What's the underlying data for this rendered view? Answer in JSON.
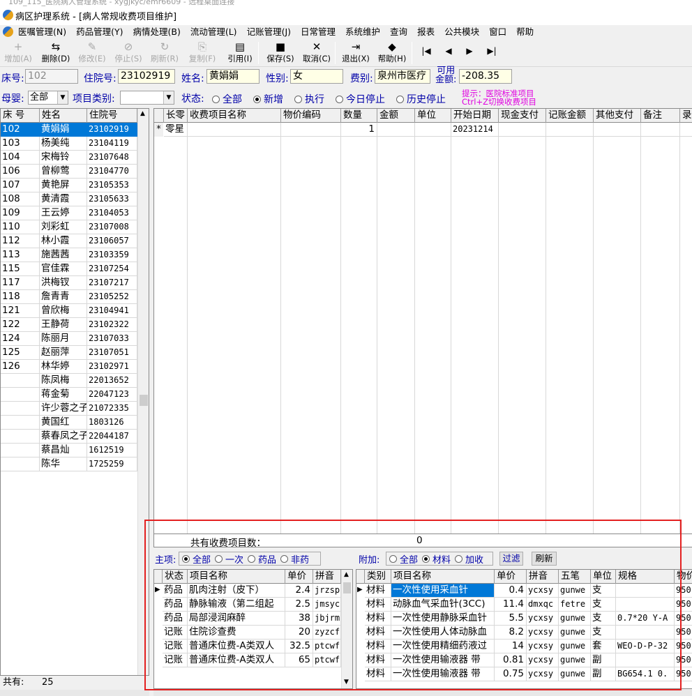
{
  "window": {
    "title_partial": "109_115_医院病人管理系统 - xygjkyc/emr6609 - 远程桌面连接",
    "title": "病区护理系统 - [病人常规收费项目维护]"
  },
  "menu": [
    "医嘱管理(N)",
    "药品管理(Y)",
    "病情处理(B)",
    "流动管理(L)",
    "记账管理(J)",
    "日常管理",
    "系统维护",
    "查询",
    "报表",
    "公共模块",
    "窗口",
    "帮助"
  ],
  "toolbar": [
    {
      "label": "增加(A)",
      "icon": "+",
      "enabled": false
    },
    {
      "label": "删除(D)",
      "icon": "⇆",
      "enabled": true
    },
    {
      "label": "修改(E)",
      "icon": "✎",
      "enabled": false
    },
    {
      "label": "停止(S)",
      "icon": "⊘",
      "enabled": false
    },
    {
      "label": "刷新(R)",
      "icon": "↻",
      "enabled": false
    },
    {
      "label": "复制(F)",
      "icon": "⎘",
      "enabled": false
    },
    {
      "label": "引用(I)",
      "icon": "▤",
      "enabled": true
    },
    {
      "label": "保存(S)",
      "icon": "■",
      "enabled": true
    },
    {
      "label": "取消(C)",
      "icon": "✕",
      "enabled": true
    },
    {
      "label": "退出(X)",
      "icon": "⇥",
      "enabled": true
    },
    {
      "label": "帮助(H)",
      "icon": "◆",
      "enabled": true
    }
  ],
  "nav": [
    "|◀",
    "◀",
    "▶",
    "▶|"
  ],
  "form": {
    "bed_label": "床号:",
    "bed_value": "102",
    "admission_label": "住院号:",
    "admission_value": "23102919",
    "name_label": "姓名:",
    "name_value": "黄娟娟",
    "gender_label": "性别:",
    "gender_value": "女",
    "fee_label": "费别:",
    "fee_value": "泉州市医疗",
    "balance_label_1": "可用",
    "balance_label_2": "金额:",
    "balance_value": "-208.35",
    "mother_label": "母婴:",
    "mother_value": "全部",
    "category_label": "项目类别:",
    "category_value": "",
    "status_label": "状态:",
    "status_options": [
      "全部",
      "新增",
      "执行",
      "今日停止",
      "历史停止"
    ],
    "status_selected": "新增",
    "hint_1": "提示：医院标准项目",
    "hint_2": "Ctrl+Z切换收费项目"
  },
  "patients": {
    "headers": [
      "床 号",
      "姓名",
      "住院号"
    ],
    "rows": [
      [
        "102",
        "黄娟娟",
        "23102919"
      ],
      [
        "103",
        "杨美纯",
        "23104119"
      ],
      [
        "104",
        "宋梅铃",
        "23107648"
      ],
      [
        "106",
        "曾柳莺",
        "23104770"
      ],
      [
        "107",
        "黄艳屏",
        "23105353"
      ],
      [
        "108",
        "黄清霞",
        "23105633"
      ],
      [
        "109",
        "王云婷",
        "23104053"
      ],
      [
        "110",
        "刘彩虹",
        "23107008"
      ],
      [
        "112",
        "林小霞",
        "23106057"
      ],
      [
        "113",
        "施茜茜",
        "23103359"
      ],
      [
        "115",
        "官佳霖",
        "23107254"
      ],
      [
        "117",
        "洪梅钗",
        "23107217"
      ],
      [
        "118",
        "詹青青",
        "23105252"
      ],
      [
        "121",
        "曾欣梅",
        "23104941"
      ],
      [
        "122",
        "王静荷",
        "23102322"
      ],
      [
        "124",
        "陈丽月",
        "23107033"
      ],
      [
        "125",
        "赵丽萍",
        "23107051"
      ],
      [
        "126",
        "林华婷",
        "23102971"
      ],
      [
        "",
        "陈凤梅",
        "22013652"
      ],
      [
        "",
        "蒋金菊",
        "22047123"
      ],
      [
        "",
        "许少蓉之子",
        "21072335"
      ],
      [
        "",
        "黄国红",
        "1803126"
      ],
      [
        "",
        "蔡春凤之子",
        "22044187"
      ],
      [
        "",
        "蔡昌灿",
        "1612519"
      ],
      [
        "",
        "陈华",
        "1725259"
      ]
    ],
    "footer_label": "共有:",
    "footer_count": "25"
  },
  "items": {
    "headers": [
      "长零",
      "收费项目名称",
      "物价编码",
      "数量",
      "金额",
      "单位",
      "开始日期",
      "现金支付",
      "记账金额",
      "其他支付",
      "备注",
      "录"
    ],
    "rows": [
      [
        "零星",
        "",
        "",
        "1",
        "",
        "",
        "20231214",
        "",
        "",
        "",
        "",
        ""
      ]
    ],
    "new_marker": "*",
    "summary_label": "共有收费项目数：",
    "summary_value": "0"
  },
  "main_panel": {
    "label": "主项:",
    "options": [
      "全部",
      "一次",
      "药品",
      "非药"
    ],
    "selected": "全部",
    "headers": [
      "状态",
      "项目名称",
      "单价",
      "拼音"
    ],
    "rows": [
      [
        "药品",
        "肌肉注射（皮下）",
        "2.4",
        "jrzsp"
      ],
      [
        "药品",
        "静脉输液（第二组起",
        "2.5",
        "jmsyc"
      ],
      [
        "药品",
        "局部浸润麻醉",
        "38",
        "jbjrm"
      ],
      [
        "记账",
        "住院诊查费",
        "20",
        "zyzcf"
      ],
      [
        "记账",
        "普通床位费-A类双人",
        "32.5",
        "ptcwf"
      ],
      [
        "记账",
        "普通床位费-A类双人",
        "65",
        "ptcwf"
      ]
    ]
  },
  "extra_panel": {
    "label": "附加:",
    "options": [
      "全部",
      "材料",
      "加收"
    ],
    "selected": "材料",
    "filter_button": "过滤",
    "refresh_button": "刷新",
    "headers": [
      "类别",
      "项目名称",
      "单价",
      "拼音",
      "五笔",
      "单位",
      "规格",
      "物价"
    ],
    "rows": [
      [
        "材料",
        "一次性使用采血针",
        "0.4",
        "ycxsy",
        "gunwe",
        "支",
        "",
        "950"
      ],
      [
        "材料",
        "动脉血气采血针(3CC)",
        "11.4",
        "dmxqc",
        "fetre",
        "支",
        "",
        "950"
      ],
      [
        "材料",
        "一次性使用静脉采血针",
        "5.5",
        "ycxsy",
        "gunwe",
        "支",
        "0.7*20 Y-A",
        "950"
      ],
      [
        "材料",
        "一次性使用人体动脉血",
        "8.2",
        "ycxsy",
        "gunwe",
        "支",
        "",
        "950"
      ],
      [
        "材料",
        "一次性使用精细药液过",
        "14",
        "ycxsy",
        "gunwe",
        "套",
        "WEO-D-P-32",
        "950"
      ],
      [
        "材料",
        "一次性使用输液器 带",
        "0.81",
        "ycxsy",
        "gunwe",
        "副",
        "",
        "950"
      ],
      [
        "材料",
        "一次性使用输液器 带",
        "0.75",
        "ycxsy",
        "gunwe",
        "副",
        "BG654.1 0.",
        "950"
      ]
    ]
  }
}
